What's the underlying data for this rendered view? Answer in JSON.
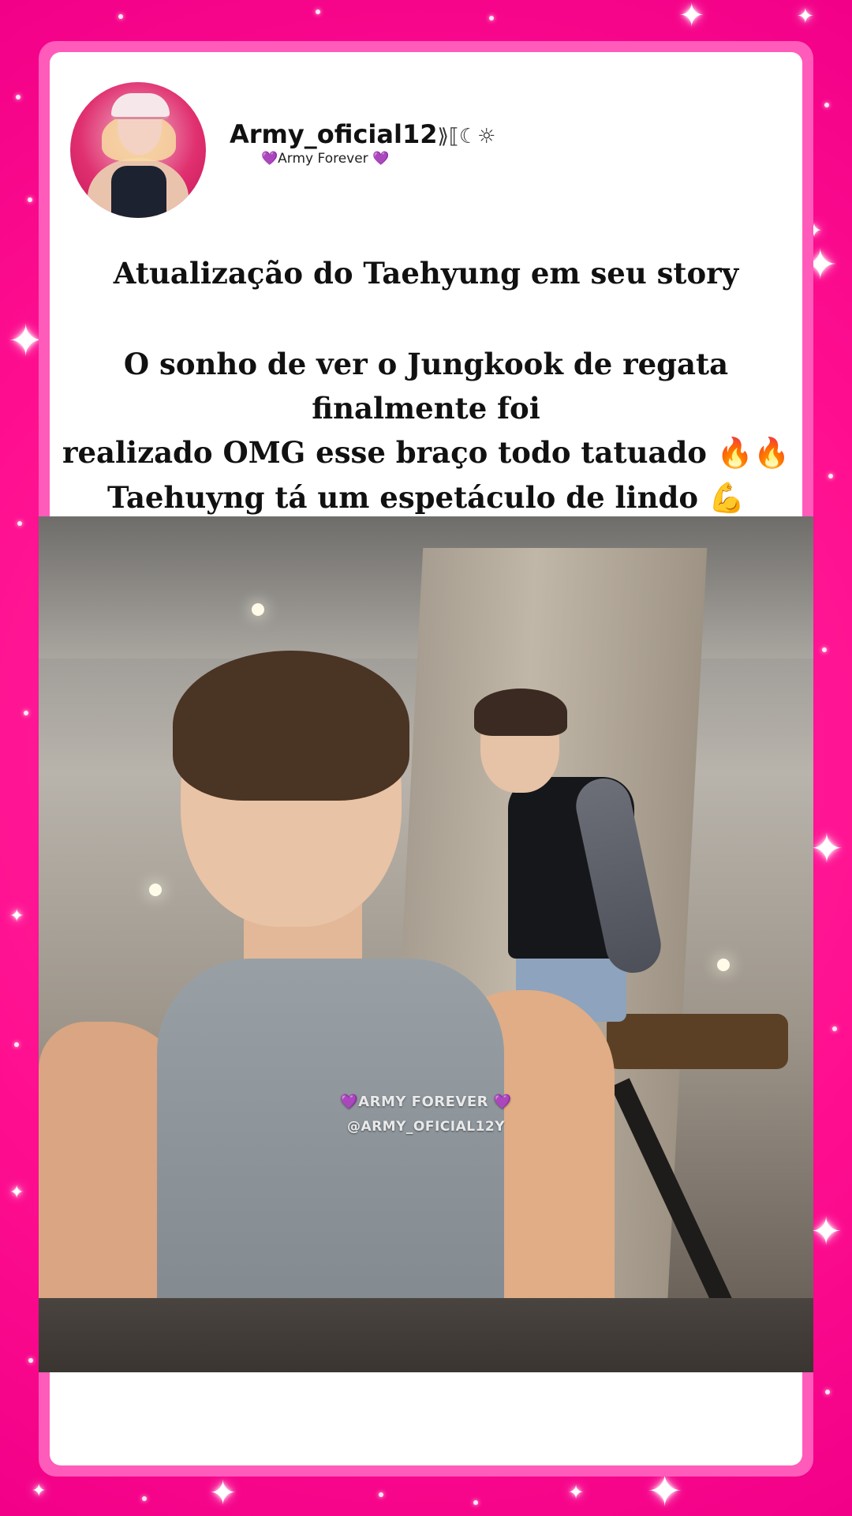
{
  "post": {
    "username": "Army_oficial12",
    "username_deco": "⟫⟦☾☼",
    "bio_text": "Army Forever",
    "bio_heart": "💜",
    "headline": "Atualização do Taehyung em seu story",
    "body_line1": "O sonho de ver o Jungkook de regata finalmente foi",
    "body_line2": "realizado OMG esse braço todo tatuado",
    "body_line2_emoji": "🔥🔥",
    "body_line3": "Taehuyng tá um espetáculo de lindo",
    "body_line3_emoji": "💪"
  },
  "watermark": {
    "line1": "ARMY FOREVER",
    "line1_heart": "💜",
    "line2": "@ARMY_OFICIAL12Y"
  },
  "colors": {
    "background": "#ff1493",
    "frame": "#ff5bbb",
    "card": "#ffffff",
    "text": "#111111",
    "heart": "#8e44ad"
  },
  "icons": {
    "sparkle": "sparkle-icon",
    "heart": "purple-heart-icon",
    "fire": "fire-icon",
    "muscle": "flexed-biceps-icon"
  }
}
